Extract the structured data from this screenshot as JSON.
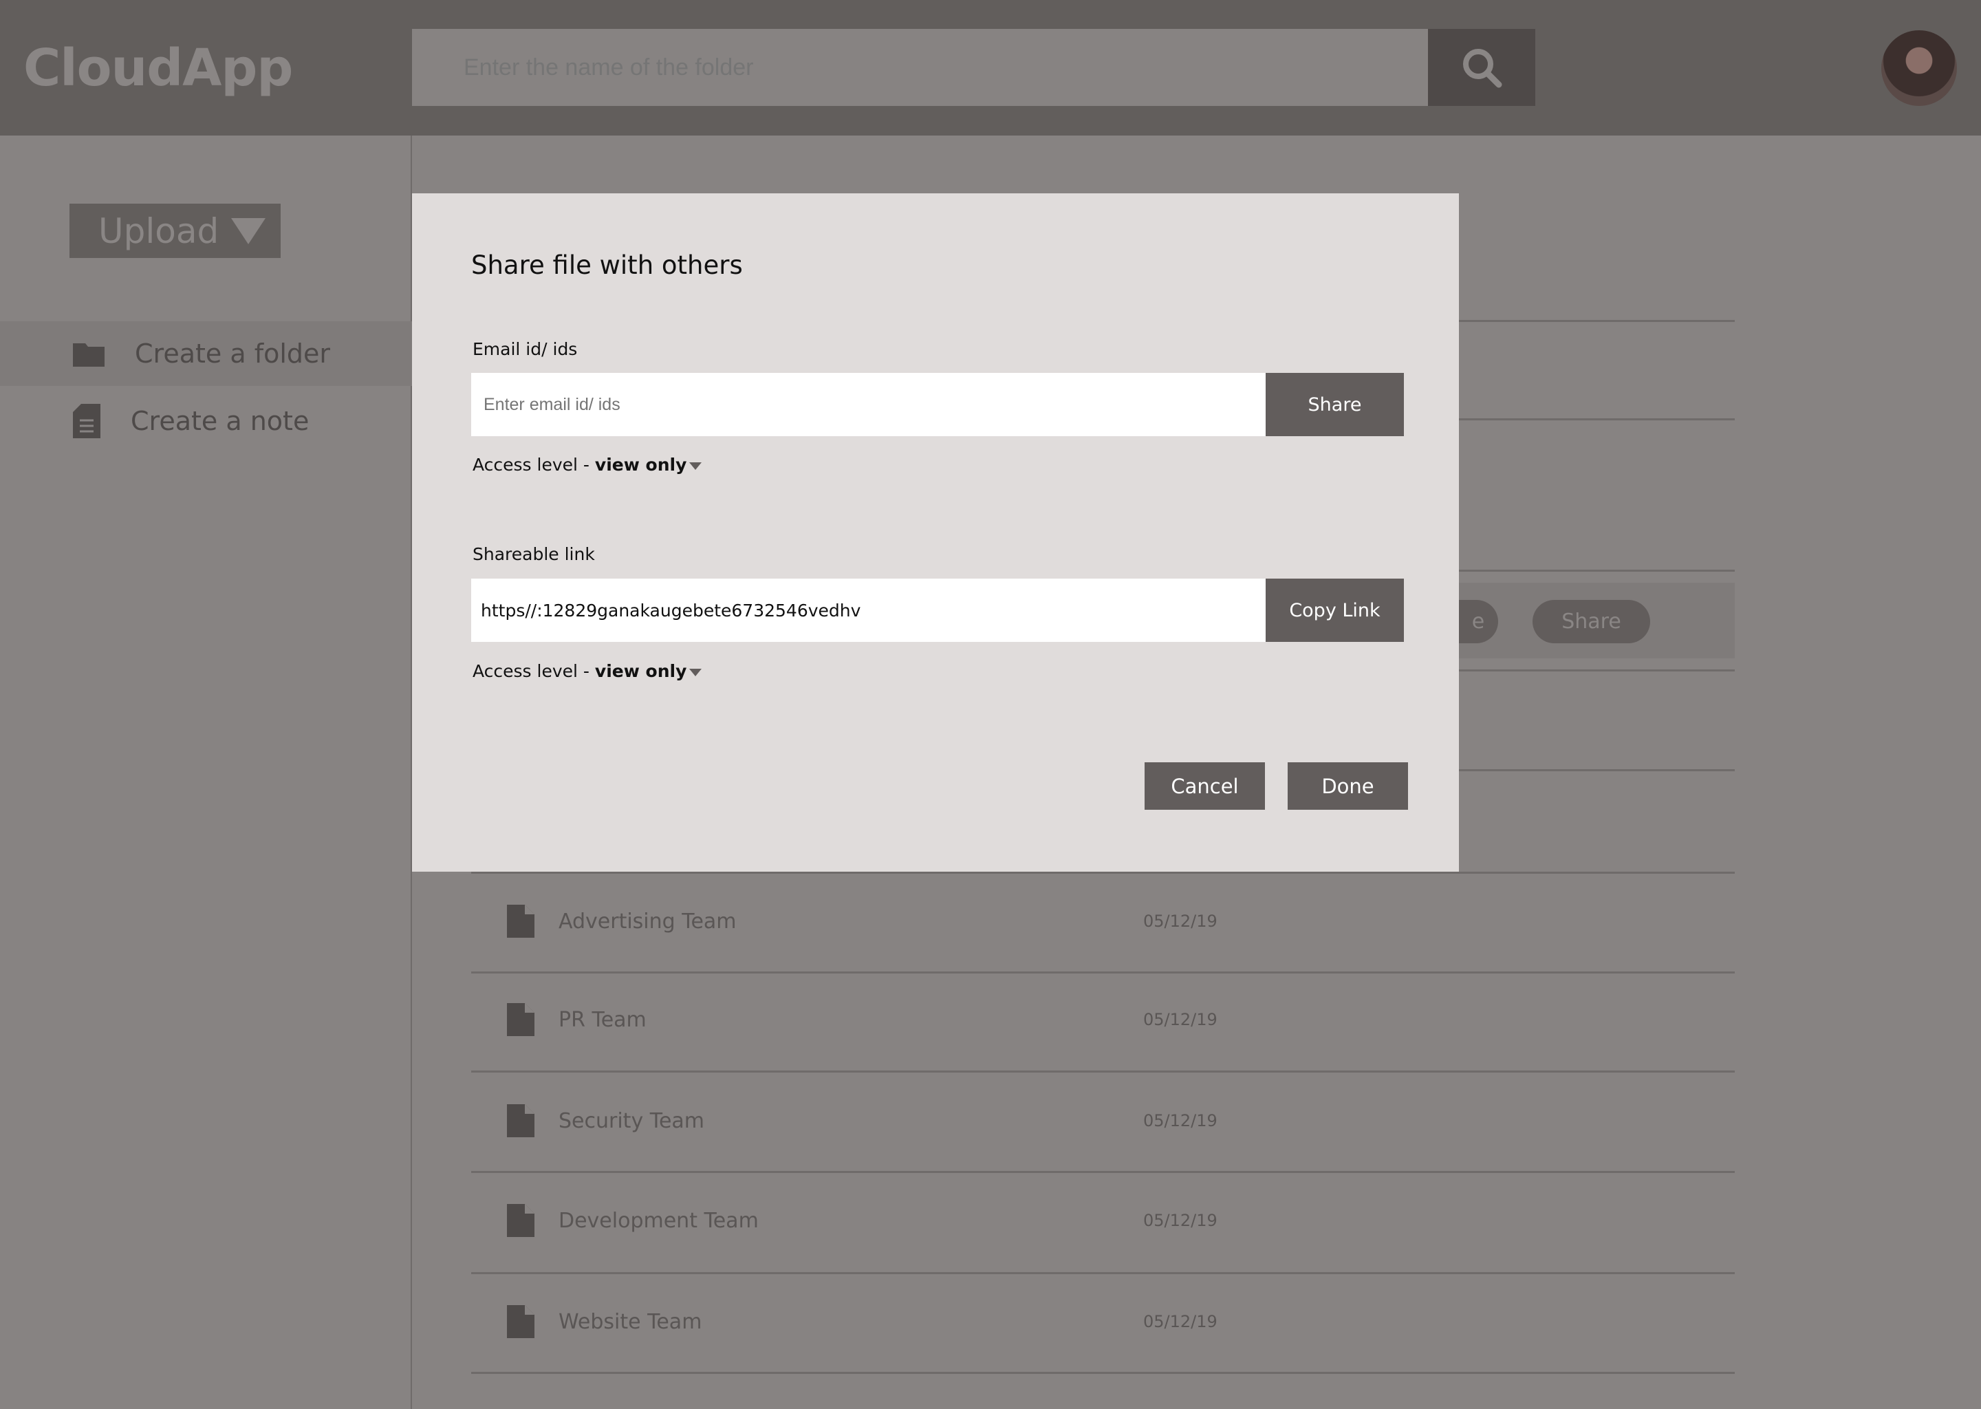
{
  "header": {
    "logo": "CloudApp",
    "search_placeholder": "Enter the name of the folder",
    "search_icon": "magnifier-icon",
    "avatar": "user-avatar"
  },
  "sidebar": {
    "upload_label": "Upload",
    "items": [
      {
        "label": "Create a folder",
        "icon": "folder-icon"
      },
      {
        "label": "Create a note",
        "icon": "note-icon"
      }
    ]
  },
  "list": {
    "visible_actions": [
      "e",
      "Share"
    ],
    "files": [
      {
        "name": "Advertising Team",
        "date": "05/12/19"
      },
      {
        "name": "PR Team",
        "date": "05/12/19"
      },
      {
        "name": "Security Team",
        "date": "05/12/19"
      },
      {
        "name": "Development Team",
        "date": "05/12/19"
      },
      {
        "name": "Website Team",
        "date": "05/12/19"
      }
    ]
  },
  "modal": {
    "title": "Share file with others",
    "email_label": "Email id/ ids",
    "email_placeholder": "Enter email id/ ids",
    "share_button": "Share",
    "access_prefix": "Access level - ",
    "access_value": "view only",
    "link_label": "Shareable link",
    "link_value": "https//:12829ganakaugebete6732546vedhv",
    "copy_button": "Copy Link",
    "link_access_prefix": "Access level - ",
    "link_access_value": "view only",
    "cancel": "Cancel",
    "done": "Done"
  },
  "colors": {
    "header": "#625e5c",
    "backdrop": "#878382",
    "modal": "#e0dcdb",
    "button": "#625d5c"
  }
}
